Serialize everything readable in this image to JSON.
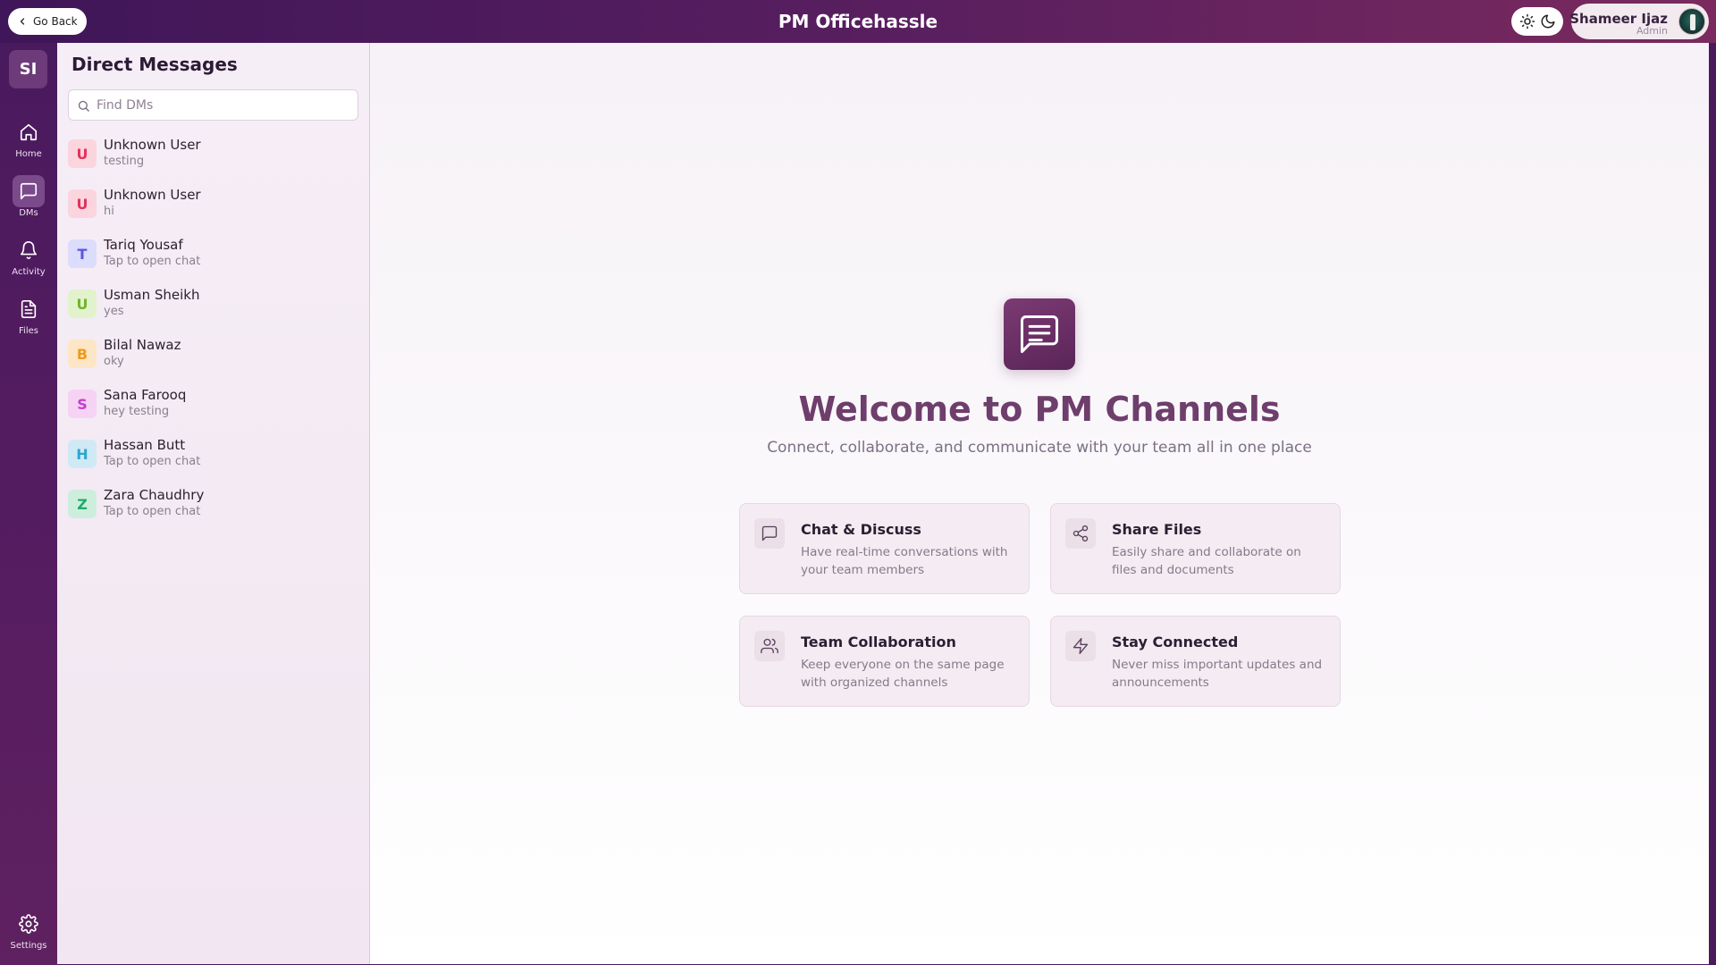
{
  "header": {
    "go_back_label": "Go Back",
    "app_title": "PM Officehassle",
    "user": {
      "name": "Shameer Ijaz",
      "role": "Admin"
    }
  },
  "rail": {
    "workspace_initials": "SI",
    "items": [
      {
        "label": "Home",
        "icon": "home-icon"
      },
      {
        "label": "DMs",
        "icon": "message-square-icon",
        "active": true
      },
      {
        "label": "Activity",
        "icon": "bell-icon"
      },
      {
        "label": "Files",
        "icon": "file-icon"
      }
    ],
    "settings_label": "Settings"
  },
  "sidebar": {
    "title": "Direct Messages",
    "search_placeholder": "Find DMs",
    "dms": [
      {
        "initial": "U",
        "name": "Unknown User",
        "last": "testing",
        "bg": "#fbd5de",
        "fg": "#e2325d"
      },
      {
        "initial": "U",
        "name": "Unknown User",
        "last": "hi",
        "bg": "#fbd5de",
        "fg": "#e2325d"
      },
      {
        "initial": "T",
        "name": "Tariq Yousaf",
        "last": "Tap to open chat",
        "bg": "#dcdcfb",
        "fg": "#5b56e0"
      },
      {
        "initial": "U",
        "name": "Usman Sheikh",
        "last": "yes",
        "bg": "#e2f2cc",
        "fg": "#6fb52a"
      },
      {
        "initial": "B",
        "name": "Bilal Nawaz",
        "last": "oky",
        "bg": "#fde6c6",
        "fg": "#ef9a1c"
      },
      {
        "initial": "S",
        "name": "Sana Farooq",
        "last": "hey testing",
        "bg": "#f6d3f4",
        "fg": "#c93ad1"
      },
      {
        "initial": "H",
        "name": "Hassan Butt",
        "last": "Tap to open chat",
        "bg": "#cfeaf5",
        "fg": "#2ca6cf"
      },
      {
        "initial": "Z",
        "name": "Zara Chaudhry",
        "last": "Tap to open chat",
        "bg": "#cdeedd",
        "fg": "#25a86c"
      }
    ]
  },
  "main": {
    "welcome_title": "Welcome to PM Channels",
    "tagline": "Connect, collaborate, and communicate with your team all in one place",
    "cards": [
      {
        "title": "Chat & Discuss",
        "desc": "Have real-time conversations with your team members",
        "icon": "message-square-icon"
      },
      {
        "title": "Share Files",
        "desc": "Easily share and collaborate on files and documents",
        "icon": "share-icon"
      },
      {
        "title": "Team Collaboration",
        "desc": "Keep everyone on the same page with organized channels",
        "icon": "users-icon"
      },
      {
        "title": "Stay Connected",
        "desc": "Never miss important updates and announcements",
        "icon": "zap-icon"
      }
    ]
  },
  "colors": {
    "accent": "#5a2558",
    "topbar": "#4a1a5e"
  }
}
